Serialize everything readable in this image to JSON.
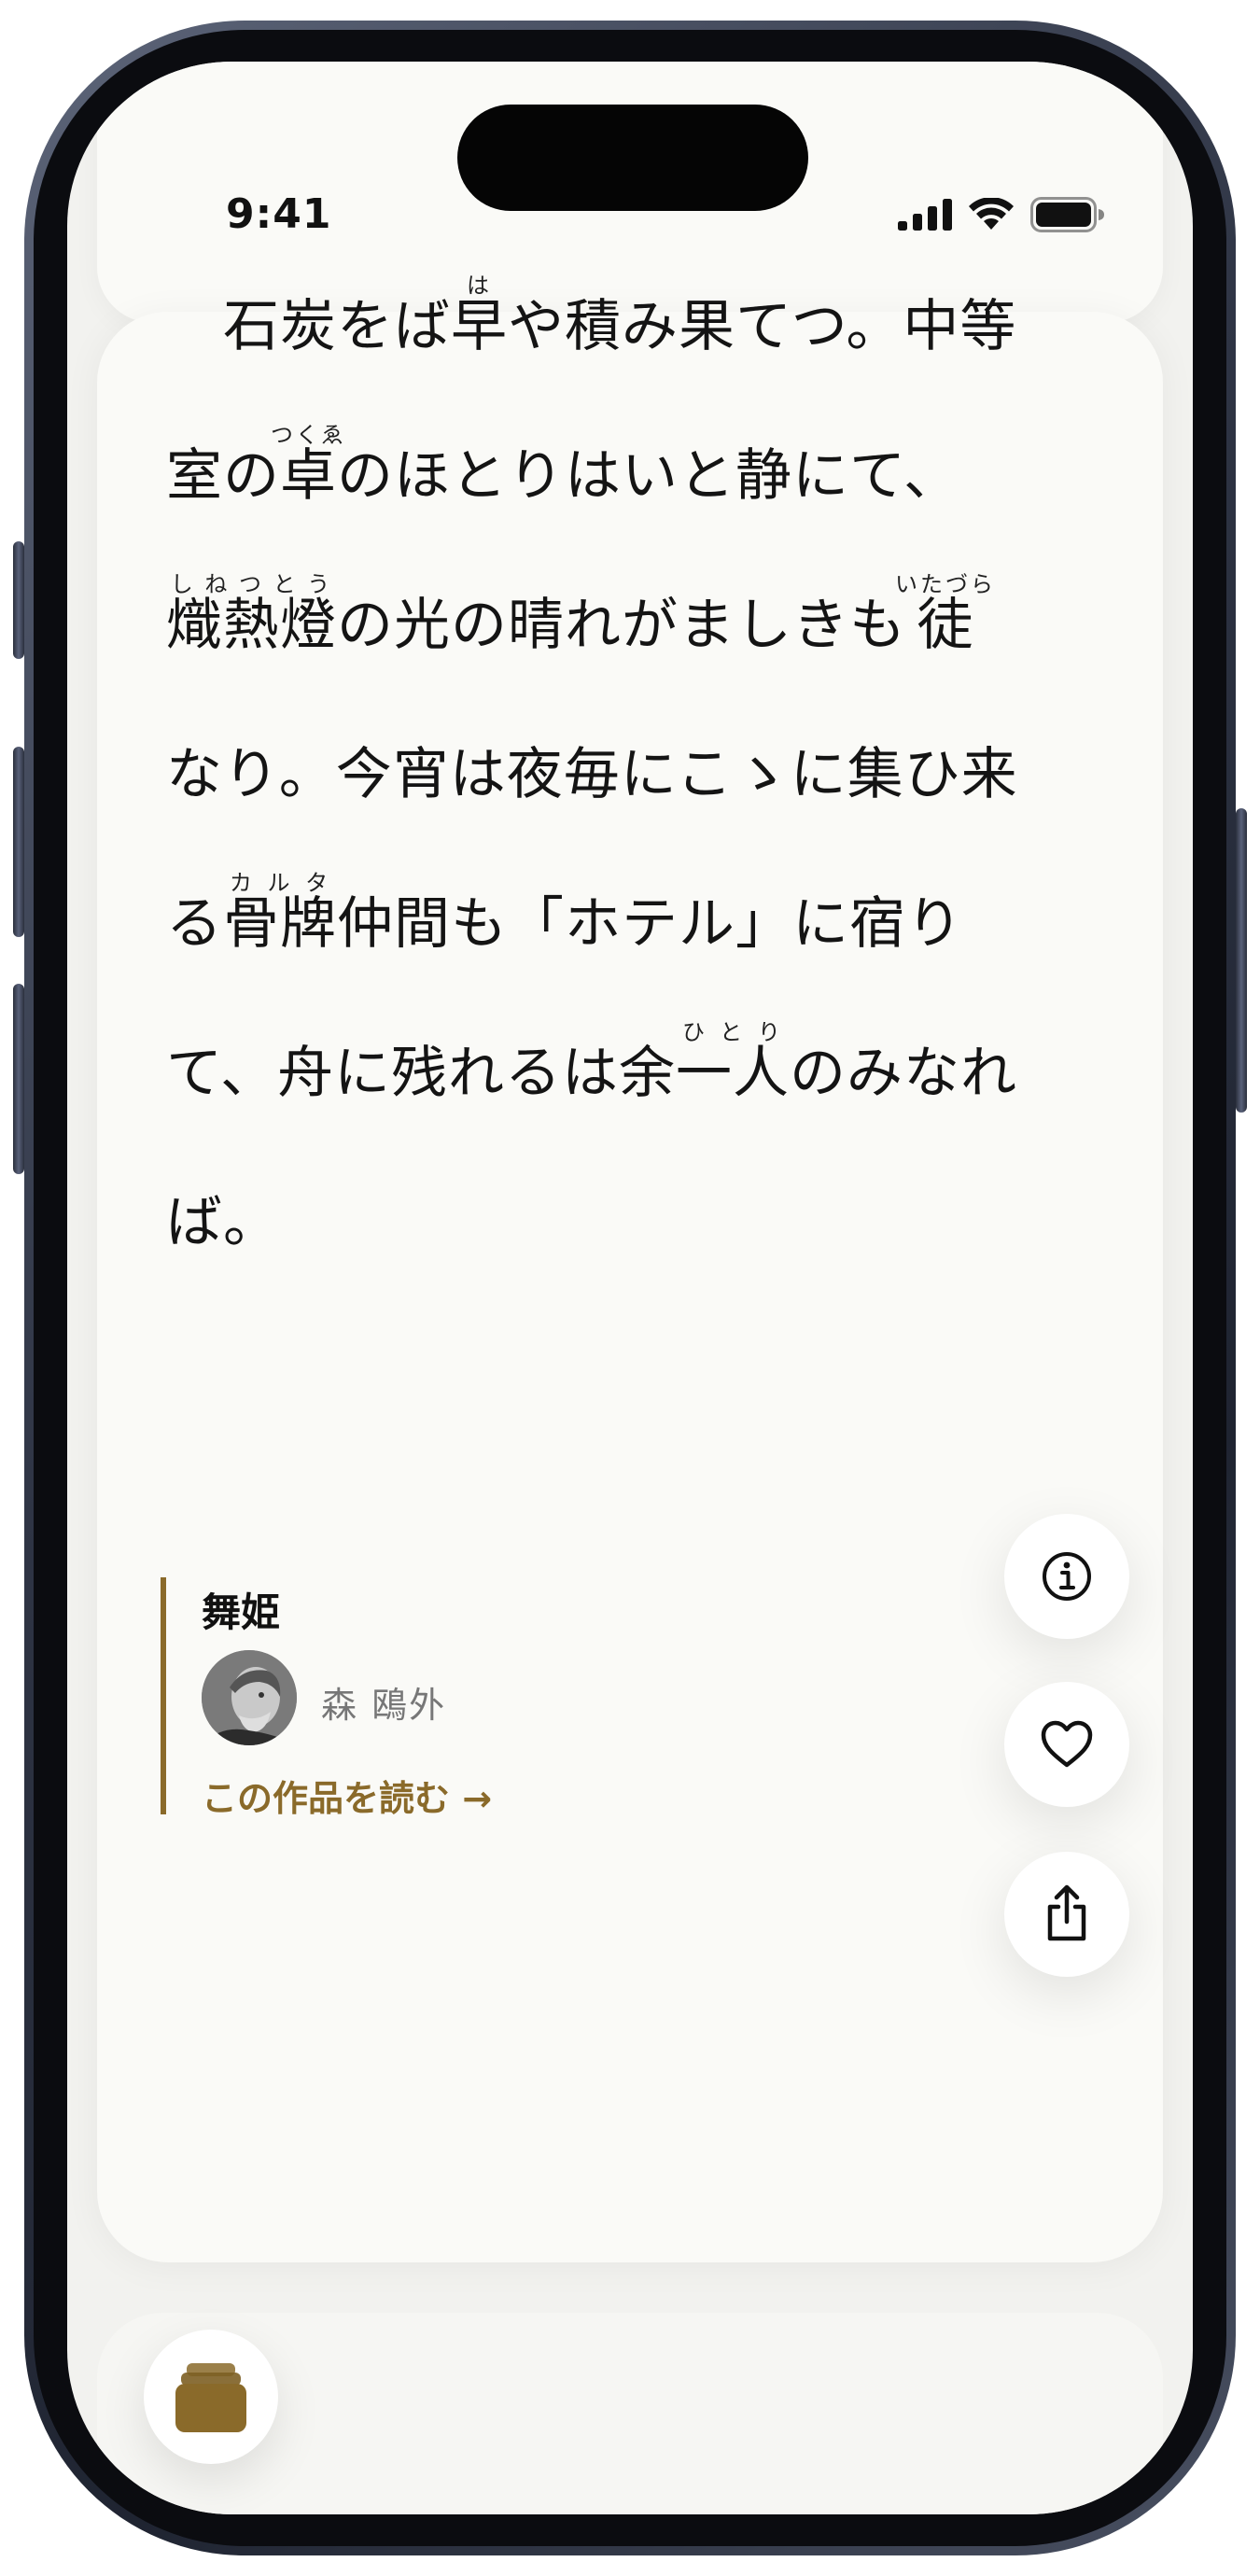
{
  "status_bar": {
    "time": "9:41",
    "icons": [
      "cellular-signal-icon",
      "wifi-icon",
      "battery-icon"
    ]
  },
  "verse": {
    "lines": [
      [
        {
          "t": "　石炭をば"
        },
        {
          "t": "早",
          "r": "は"
        },
        {
          "t": "や積み果てつ。中等"
        }
      ],
      [
        {
          "t": "室の"
        },
        {
          "t": "卓",
          "r": "つくゑ"
        },
        {
          "t": "のほとりはいと静にて、"
        }
      ],
      [
        {
          "t": "熾熱燈",
          "r": "しねつとう"
        },
        {
          "t": "の光の晴れがましきも"
        },
        {
          "t": "徒",
          "r": "いたづら"
        }
      ],
      [
        {
          "t": "なり。今宵は夜毎にこゝに集ひ来"
        }
      ],
      [
        {
          "t": "る"
        },
        {
          "t": "骨牌",
          "r": "カルタ"
        },
        {
          "t": "仲間も「ホテル」に宿り"
        }
      ],
      [
        {
          "t": "て、舟に残れるは余"
        },
        {
          "t": "一人",
          "r": "ひとり"
        },
        {
          "t": "のみなれ"
        }
      ],
      [
        {
          "t": "ば。"
        }
      ]
    ]
  },
  "work": {
    "title": "舞姫",
    "author": "森 鴎外",
    "read_link": "この作品を読む →",
    "accent_color": "#8a6a2a"
  },
  "actions": {
    "info_icon": "info-icon",
    "favorite_icon": "heart-icon",
    "share_icon": "share-icon"
  },
  "bottom": {
    "library_icon": "library-stack-icon",
    "library_color": "#8a6a2a"
  }
}
